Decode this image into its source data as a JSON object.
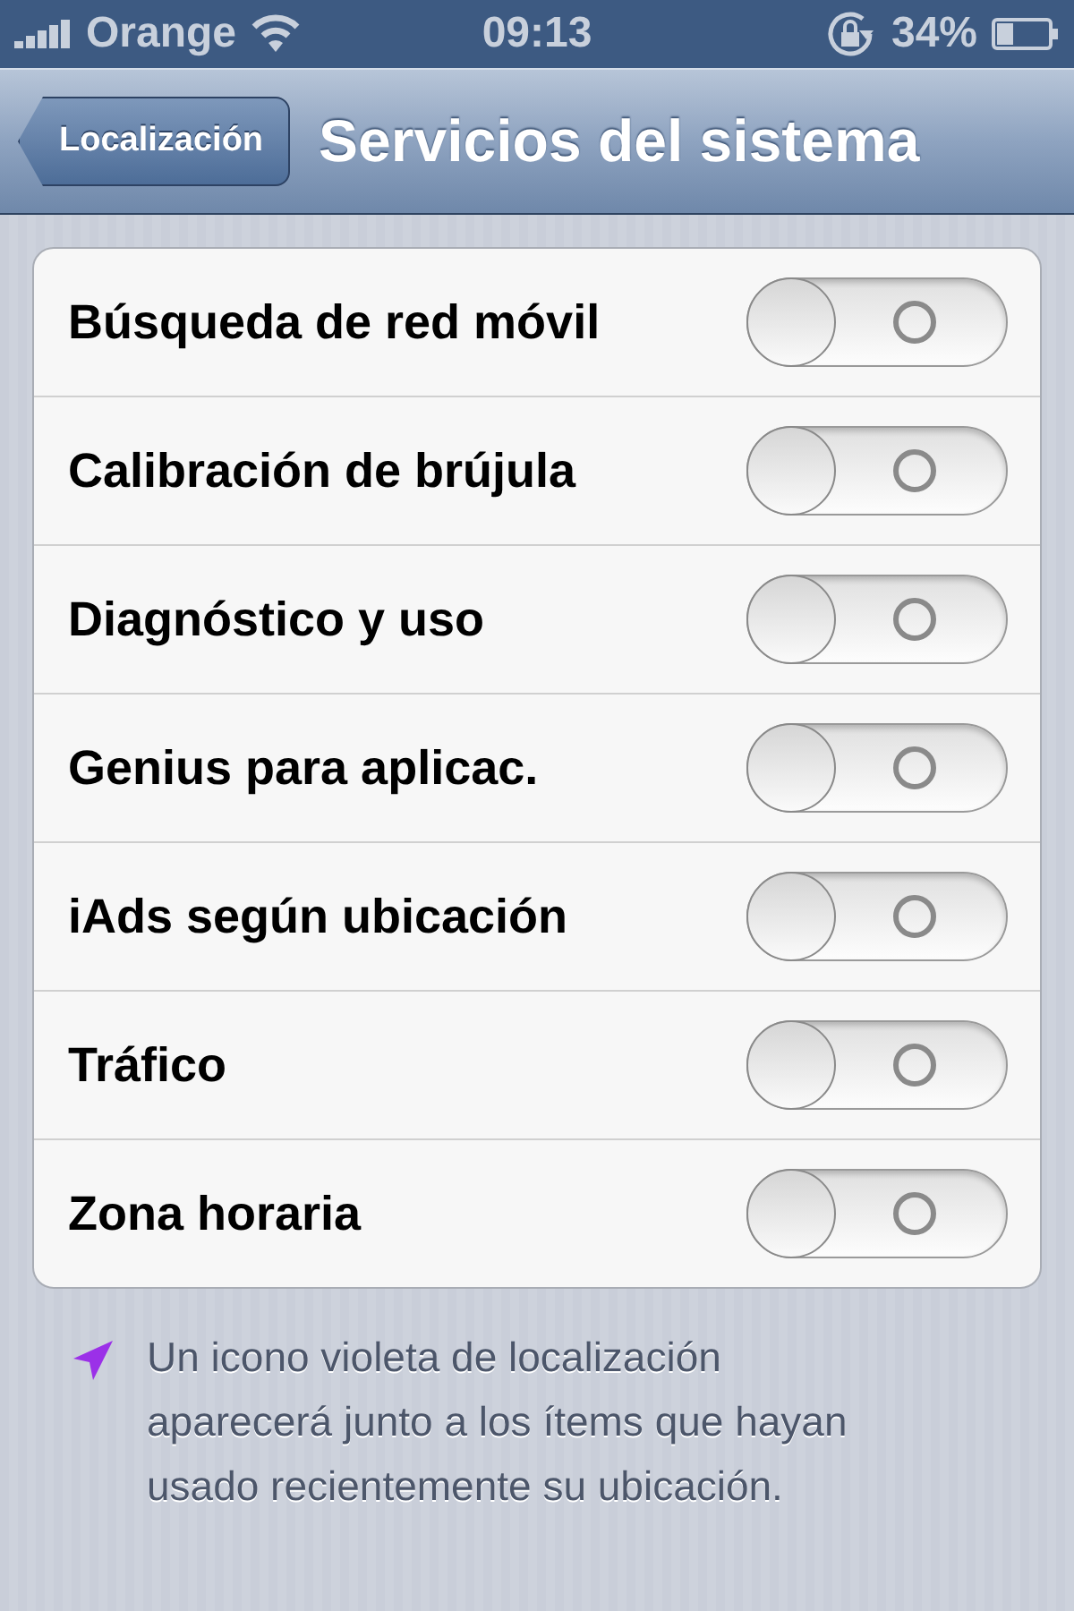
{
  "status_bar": {
    "carrier": "Orange",
    "time": "09:13",
    "battery": "34%"
  },
  "nav_bar": {
    "back": "Localización",
    "title": "Servicios del sistema"
  },
  "settings": [
    {
      "label": "Búsqueda de red móvil",
      "on": false
    },
    {
      "label": "Calibración de brújula",
      "on": false
    },
    {
      "label": "Diagnóstico y uso",
      "on": false
    },
    {
      "label": "Genius para aplicac.",
      "on": false
    },
    {
      "label": "iAds según ubicación",
      "on": false
    },
    {
      "label": "Tráfico",
      "on": false
    },
    {
      "label": "Zona horaria",
      "on": false
    }
  ],
  "footer": "Un icono violeta de localización aparecerá junto a los ítems que hayan usado recientemente su ubicación."
}
